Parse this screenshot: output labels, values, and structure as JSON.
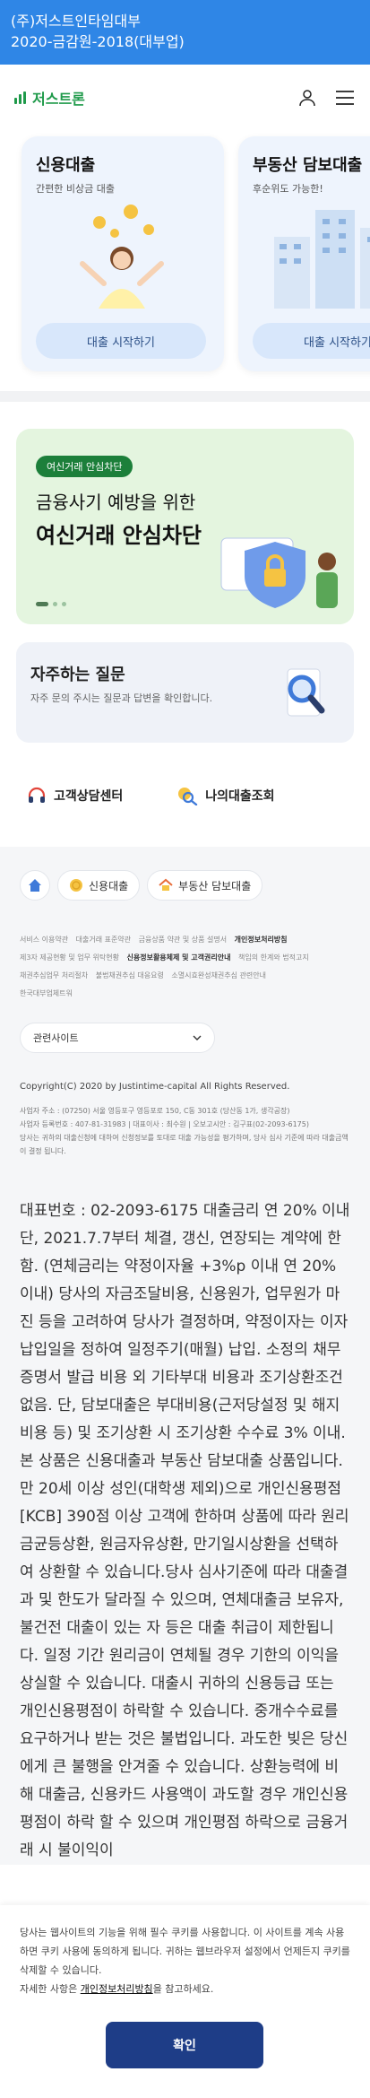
{
  "topbar": {
    "line1": "(주)저스트인타임대부",
    "line2": "2020-금감원-2018(대부업)"
  },
  "header": {
    "logo": "저스트론",
    "user_icon": "user-icon",
    "menu_icon": "menu-icon"
  },
  "cards": [
    {
      "title": "신용대출",
      "subtitle": "간편한 비상금 대출",
      "cta": "대출 시작하기"
    },
    {
      "title": "부동산 담보대출",
      "subtitle": "후순위도 가능한!",
      "cta": "대출 시작하기"
    }
  ],
  "banner": {
    "tag": "여신거래 안심차단",
    "line1": "금융사기 예방을 위한",
    "line2": "여신거래 안심차단"
  },
  "faq": {
    "title": "자주하는 질문",
    "desc": "자주 문의 주시는 질문과 답변을 확인합니다."
  },
  "quick": [
    {
      "label": "고객상담센터"
    },
    {
      "label": "나의대출조회"
    }
  ],
  "footer": {
    "pills": [
      {
        "label": "신용대출"
      },
      {
        "label": "부동산 담보대출"
      }
    ],
    "links": [
      "서비스 이용약관",
      "대출거래 표준약관",
      "금융상품 약관 및 상품 설명서",
      "개인정보처리방침",
      "제3자 제공현황 및 업무 위탁현황",
      "신용정보활용체제 및 고객권리안내",
      "책임의 한계와 법적고지",
      "채권추심업무 처리절차",
      "불법채권추심 대응요령",
      "소멸시효완성채권추심 관련안내",
      "한국대부업체트워"
    ],
    "related": "관련사이트",
    "copyright": "Copyright(C) 2020 by Justintime-capital All Rights Reserved.",
    "company": [
      "사업자 주소 : (07250) 서울 영등포구 영등포로 150, C동 301호 (당산동 1가, 생각공장)",
      "사업자 등록번호 : 407-81-31983 | 대표이사 : 최수원 | 오보고시안 : 김구표(02-2093-6175)",
      "당사는 귀하의 대출신청에 대하여 신청정보를 토대로 대출 가능성을 평가하며, 당사 심사 기준에 따라 대출금액이 결정 됩니다."
    ],
    "notice": "대표번호 : 02-2093-6175 대출금리 연 20% 이내 단, 2021.7.7부터 체결, 갱신, 연장되는 계약에 한함. (연체금리는 약정이자율 +3%p 이내 연 20% 이내) 당사의 자금조달비용, 신용원가, 업무원가 마진 등을 고려하여 당사가 결정하며, 약정이자는 이자납입일을 정하여 일정주기(매월) 납입. 소정의 채무증명서 발급 비용 외 기타부대 비용과 조기상환조건 없음. 단, 담보대출은 부대비용(근저당설정 및 해지비용 등) 및 조기상환 시 조기상환 수수료 3% 이내. 본 상품은 신용대출과 부동산 담보대출 상품입니다. 만 20세 이상 성인(대학생 제외)으로 개인신용평점 [KCB] 390점 이상 고객에 한하며 상품에 따라 원리금균등상환, 원금자유상환, 만기일시상환을 선택하여 상환할 수 있습니다.당사 심사기준에 따라 대출결과 및 한도가 달라질 수 있으며, 연체대출금 보유자, 불건전 대출이 있는 자 등은 대출 취급이 제한됩니다. 일정 기간 원리금이 연체될 경우 기한의 이익을 상실할 수 있습니다. 대출시 귀하의 신용등급 또는 개인신용평점이 하락할 수 있습니다. 중개수수료를 요구하거나 받는 것은 불법입니다. 과도한 빚은 당신에게 큰 불행을 안겨줄 수 있습니다. 상환능력에 비해 대출금, 신용카드 사용액이 과도할 경우 개인신용 평점이 하락 할 수 있으며 개인평점 하락으로 금융거래 시 불이익이"
  },
  "cookie": {
    "text1": "당사는 웹사이트의 기능을 위해 필수 쿠키를 사용합니다. 이 사이트를 계속 사용하면 쿠키 사용에 동의하게 됩니다. 귀하는 웹브라우저 설정에서 언제든지 쿠키를 삭제할 수 있습니다.",
    "text2": "자세한 사항은 ",
    "link": "개인정보처리방침",
    "text3": "을 참고하세요.",
    "confirm": "확인"
  }
}
